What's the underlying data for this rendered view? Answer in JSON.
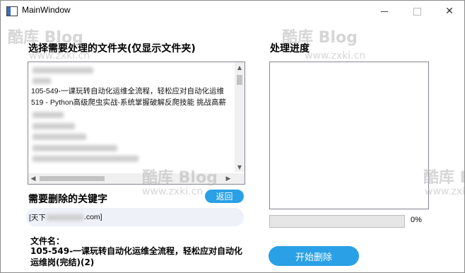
{
  "window": {
    "title": "MainWindow",
    "minimize_glyph": "—",
    "close_glyph": "✕"
  },
  "left_panel": {
    "heading": "选择需要处理的文件夹(仅显示文件夹)",
    "folder_list": {
      "visible_items": [
        "105-549-一课玩转自动化运维全流程，轻松应对自动化运维",
        "519 - Python高级爬虫实战-系统掌握破解反爬技能 挑战高薪"
      ],
      "scroll_up_glyph": "▲",
      "scroll_down_glyph": "▼",
      "scroll_left_glyph": "◀",
      "scroll_right_glyph": "▶"
    },
    "keyword_heading": "需要删除的关键字",
    "back_button": "返回",
    "keyword_input": {
      "prefix": "[天下",
      "suffix": ".com]"
    },
    "filename_label": "文件名：",
    "filename_value": "105-549-一课玩转自动化运维全流程，轻松应对自动化运维岗(完结)(2)"
  },
  "right_panel": {
    "heading": "处理进度",
    "progress_percent": 0,
    "progress_label": "0%",
    "start_button": "开始删除"
  },
  "watermark": {
    "logo": "酷库 Blog",
    "url": "www.zxki.cn"
  }
}
